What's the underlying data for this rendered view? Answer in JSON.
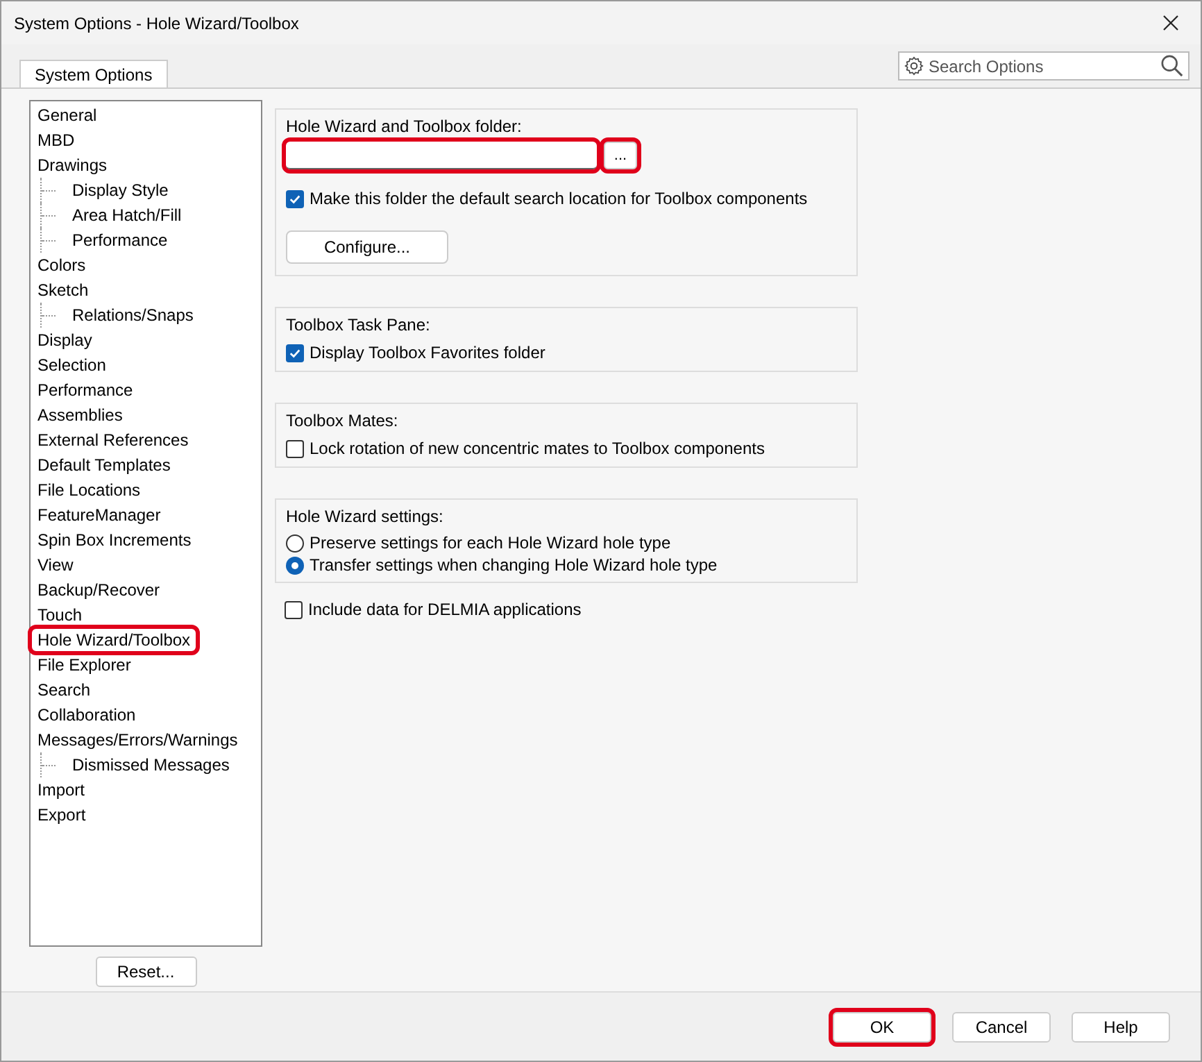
{
  "window": {
    "title": "System Options - Hole Wizard/Toolbox"
  },
  "tabs": [
    {
      "label": "System Options",
      "selected": true
    }
  ],
  "search": {
    "placeholder": "Search Options"
  },
  "tree": [
    {
      "label": "General",
      "highlighted": false
    },
    {
      "label": "MBD",
      "highlighted": false
    },
    {
      "label": "Drawings",
      "highlighted": false,
      "children": [
        {
          "label": "Display Style",
          "highlighted": false
        },
        {
          "label": "Area Hatch/Fill",
          "highlighted": false
        },
        {
          "label": "Performance",
          "highlighted": false
        }
      ]
    },
    {
      "label": "Colors",
      "highlighted": false
    },
    {
      "label": "Sketch",
      "highlighted": false,
      "children": [
        {
          "label": "Relations/Snaps",
          "highlighted": false
        }
      ]
    },
    {
      "label": "Display",
      "highlighted": false
    },
    {
      "label": "Selection",
      "highlighted": false
    },
    {
      "label": "Performance",
      "highlighted": false
    },
    {
      "label": "Assemblies",
      "highlighted": false
    },
    {
      "label": "External References",
      "highlighted": false
    },
    {
      "label": "Default Templates",
      "highlighted": false
    },
    {
      "label": "File Locations",
      "highlighted": false
    },
    {
      "label": "FeatureManager",
      "highlighted": false
    },
    {
      "label": "Spin Box Increments",
      "highlighted": false
    },
    {
      "label": "View",
      "highlighted": false
    },
    {
      "label": "Backup/Recover",
      "highlighted": false
    },
    {
      "label": "Touch",
      "highlighted": false
    },
    {
      "label": "Hole Wizard/Toolbox",
      "highlighted": true
    },
    {
      "label": "File Explorer",
      "highlighted": false
    },
    {
      "label": "Search",
      "highlighted": false
    },
    {
      "label": "Collaboration",
      "highlighted": false
    },
    {
      "label": "Messages/Errors/Warnings",
      "highlighted": false,
      "children": [
        {
          "label": "Dismissed Messages",
          "highlighted": false
        }
      ]
    },
    {
      "label": "Import",
      "highlighted": false
    },
    {
      "label": "Export",
      "highlighted": false
    }
  ],
  "reset_button": "Reset...",
  "groups": [
    {
      "title": "Hole Wizard and Toolbox folder:",
      "items": [
        {
          "kind": "folder",
          "highlighted": true,
          "browse_label": "...",
          "browse_highlighted": true
        },
        {
          "kind": "checkbox",
          "label": "Make this folder the default search location for Toolbox components",
          "checked": true
        },
        {
          "kind": "button",
          "label": "Configure..."
        }
      ]
    },
    {
      "title": "Toolbox Task Pane:",
      "items": [
        {
          "kind": "checkbox",
          "label": "Display Toolbox Favorites folder",
          "checked": true
        }
      ]
    },
    {
      "title": "Toolbox Mates:",
      "items": [
        {
          "kind": "checkbox",
          "label": "Lock rotation of new concentric mates to Toolbox components",
          "checked": false
        }
      ]
    },
    {
      "title": "Hole Wizard settings:",
      "items": [
        {
          "kind": "radio",
          "label": "Preserve settings for each Hole Wizard hole type",
          "selected": false
        },
        {
          "kind": "radio",
          "label": "Transfer settings when changing Hole Wizard hole type",
          "selected": true
        }
      ]
    }
  ],
  "options": [
    {
      "kind": "checkbox",
      "label": "Include data for DELMIA applications",
      "checked": false
    }
  ],
  "footer_buttons": [
    {
      "label": "OK",
      "highlighted": true
    },
    {
      "label": "Cancel",
      "highlighted": false
    },
    {
      "label": "Help",
      "highlighted": false
    }
  ]
}
